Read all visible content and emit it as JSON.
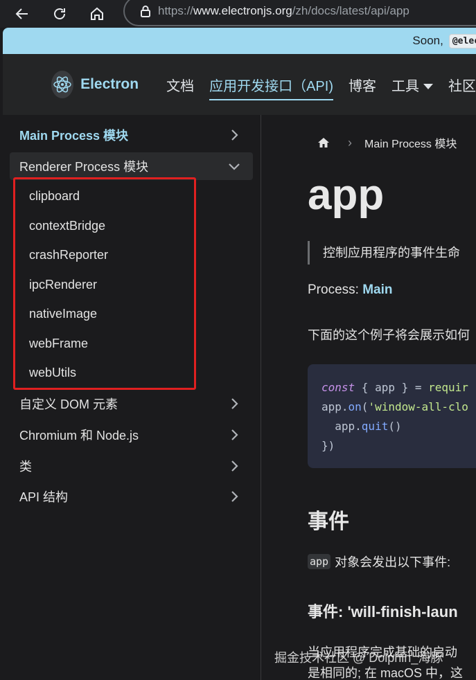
{
  "browser": {
    "url_prefix": "https://",
    "url_domain": "www.electronjs.org",
    "url_path": "/zh/docs/latest/api/app"
  },
  "banner": {
    "text": "Soon,",
    "code": "@elec"
  },
  "header": {
    "brand": "Electron",
    "nav": [
      "文档",
      "应用开发接口（API)",
      "博客",
      "工具",
      "社区"
    ]
  },
  "sidebar": {
    "main_process": "Main Process 模块",
    "renderer_process": "Renderer Process 模块",
    "renderer_items": [
      "clipboard",
      "contextBridge",
      "crashReporter",
      "ipcRenderer",
      "nativeImage",
      "webFrame",
      "webUtils"
    ],
    "custom_dom": "自定义 DOM 元素",
    "chromium_node": "Chromium 和 Node.js",
    "classes": "类",
    "api_structures": "API 结构"
  },
  "content": {
    "breadcrumb_current": "Main Process 模块",
    "title": "app",
    "quote": "控制应用程序的事件生命",
    "process_label": "Process: ",
    "process_value": "Main",
    "example_intro": "下面的这个例子将会展示如何",
    "code_line1_kw": "const",
    "code_line1_rest": " { app } = ",
    "code_line1_fn": "requir",
    "code_line2_obj": "app.",
    "code_line2_fn": "on",
    "code_line2_paren": "(",
    "code_line2_str": "'window-all-clo",
    "code_line3_obj": "  app.",
    "code_line3_fn": "quit",
    "code_line3_paren": "()",
    "code_line4": "})",
    "events_heading": "事件",
    "events_inline": "app",
    "events_text": "对象会发出以下事件:",
    "event_heading": "事件: 'will-finish-laun",
    "body_line1": "当应用程序完成基础的启动",
    "body_line2": "是相同的; 在 macOS 中，这"
  },
  "watermark": "掘金技术社区 @ Dolphin_海豚"
}
